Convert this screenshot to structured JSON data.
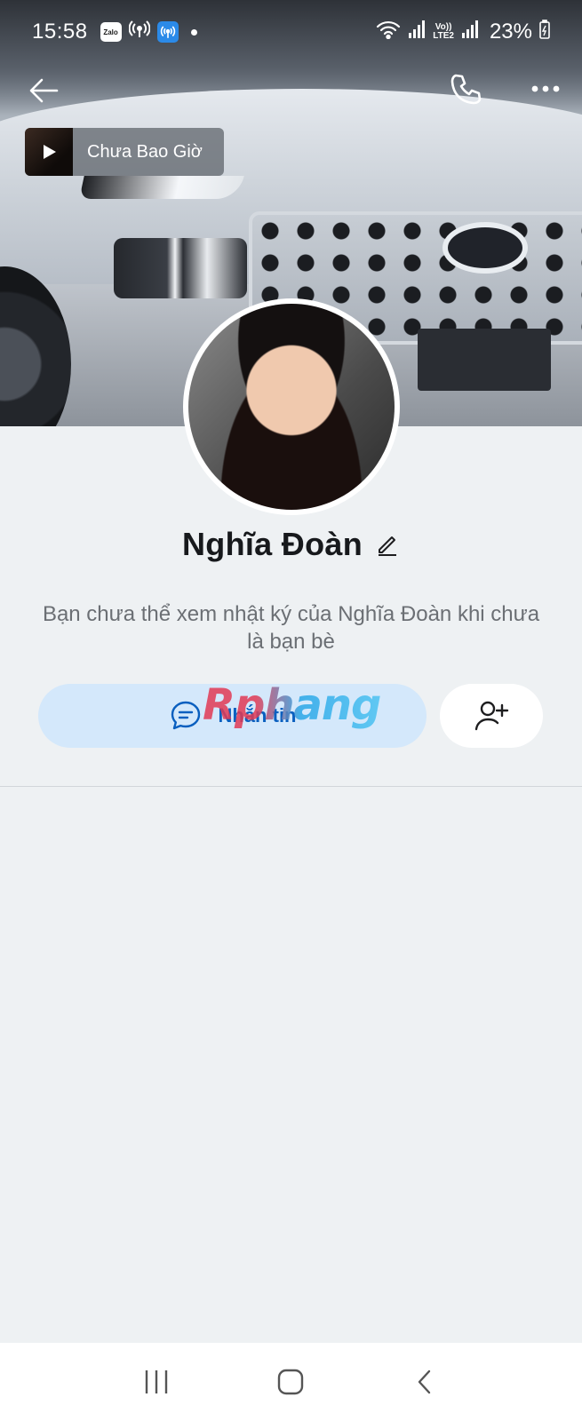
{
  "status_bar": {
    "time": "15:58",
    "zalo_label": "Zalo",
    "volte_label_top": "Vo))",
    "volte_label_bottom": "LTE2",
    "battery": "23%"
  },
  "music": {
    "title": "Chưa Bao Giờ"
  },
  "profile": {
    "name": "Nghĩa Đoàn",
    "privacy_note": "Bạn chưa thể xem nhật ký của Nghĩa Đoàn khi chưa là bạn bè"
  },
  "actions": {
    "message_label": "Nhắn tin"
  },
  "watermark": "Rphang",
  "icons": {
    "back": "arrow-left-icon",
    "call": "phone-icon",
    "more": "more-horizontal-icon",
    "edit": "pencil-icon",
    "chat": "chat-bubble-icon",
    "add_friend": "user-plus-icon",
    "nav_recents": "recents-icon",
    "nav_home": "home-icon",
    "nav_back": "nav-back-icon"
  },
  "colors": {
    "accent": "#0a5fbf",
    "message_button_bg": "#d4e8fb",
    "page_bg": "#eef1f3"
  }
}
